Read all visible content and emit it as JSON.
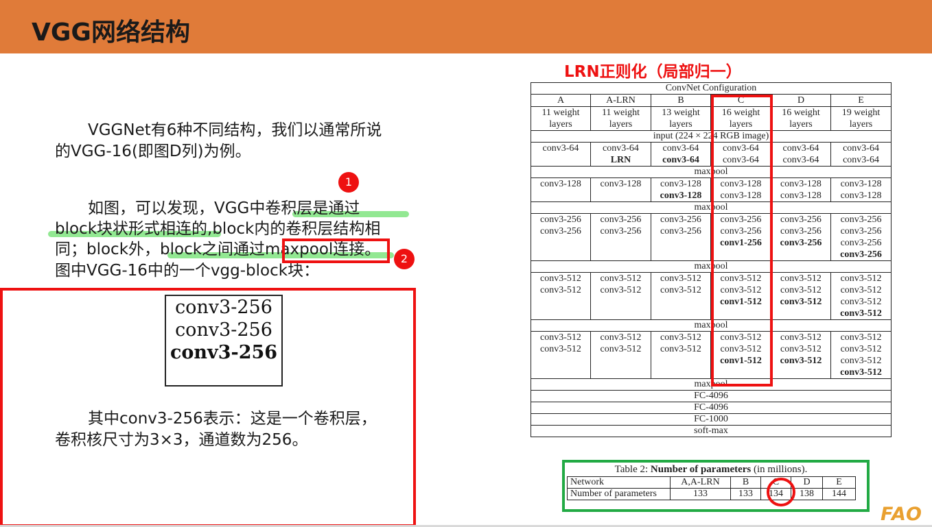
{
  "slide": {
    "title": "VGG网络结构",
    "paragraphs": {
      "p1_line1": "VGGNet有6种不同结构，我们以通常所说",
      "p1_line2": "的VGG-16(即图D列)为例。",
      "p2_line1": "如图，可以发现，VGG中卷积层是通过",
      "p2_line2": "block块状形式相连的,block内的卷积层结构相",
      "p2_line3": "同；block外，block之间通过maxpool连接。",
      "p2_line4": "图中VGG-16中的一个vgg-block块：",
      "p3_line1": "其中conv3-256表示：这是一个卷积层，",
      "p3_line2": "卷积核尺寸为3×3，通道数为256。"
    },
    "badges": [
      "1",
      "2"
    ],
    "block_figure": [
      "conv3-256",
      "conv3-256",
      "conv3-256"
    ],
    "lrn_title": "LRN正则化（局部归一）",
    "logo_text": "FAO",
    "colors": {
      "header": "#e07b39",
      "highlight": "#6ee06e",
      "red": "#ee1111",
      "green": "#22aa44"
    }
  },
  "config_table": {
    "caption": "ConvNet Configuration",
    "columns": [
      "A",
      "A-LRN",
      "B",
      "C",
      "D",
      "E"
    ],
    "descriptions": [
      [
        "11 weight",
        "layers"
      ],
      [
        "11 weight",
        "layers"
      ],
      [
        "13 weight",
        "layers"
      ],
      [
        "16 weight",
        "layers"
      ],
      [
        "16 weight",
        "layers"
      ],
      [
        "19 weight",
        "layers"
      ]
    ],
    "input": "input (224 × 224 RGB image)",
    "maxpool": "maxpool",
    "groups": [
      [
        [
          [
            "conv3-64"
          ]
        ],
        [
          [
            "conv3-64"
          ],
          [
            "LRN",
            "b"
          ]
        ],
        [
          [
            "conv3-64"
          ],
          [
            "conv3-64",
            "b"
          ]
        ],
        [
          [
            "conv3-64"
          ],
          [
            "conv3-64"
          ]
        ],
        [
          [
            "conv3-64"
          ],
          [
            "conv3-64"
          ]
        ],
        [
          [
            "conv3-64"
          ],
          [
            "conv3-64"
          ]
        ]
      ],
      [
        [
          [
            "conv3-128"
          ]
        ],
        [
          [
            "conv3-128"
          ]
        ],
        [
          [
            "conv3-128"
          ],
          [
            "conv3-128",
            "b"
          ]
        ],
        [
          [
            "conv3-128"
          ],
          [
            "conv3-128"
          ]
        ],
        [
          [
            "conv3-128"
          ],
          [
            "conv3-128"
          ]
        ],
        [
          [
            "conv3-128"
          ],
          [
            "conv3-128"
          ]
        ]
      ],
      [
        [
          [
            "conv3-256"
          ],
          [
            "conv3-256"
          ]
        ],
        [
          [
            "conv3-256"
          ],
          [
            "conv3-256"
          ]
        ],
        [
          [
            "conv3-256"
          ],
          [
            "conv3-256"
          ]
        ],
        [
          [
            "conv3-256"
          ],
          [
            "conv3-256"
          ],
          [
            "conv1-256",
            "b"
          ]
        ],
        [
          [
            "conv3-256"
          ],
          [
            "conv3-256"
          ],
          [
            "conv3-256",
            "b"
          ]
        ],
        [
          [
            "conv3-256"
          ],
          [
            "conv3-256"
          ],
          [
            "conv3-256"
          ],
          [
            "conv3-256",
            "b"
          ]
        ]
      ],
      [
        [
          [
            "conv3-512"
          ],
          [
            "conv3-512"
          ]
        ],
        [
          [
            "conv3-512"
          ],
          [
            "conv3-512"
          ]
        ],
        [
          [
            "conv3-512"
          ],
          [
            "conv3-512"
          ]
        ],
        [
          [
            "conv3-512"
          ],
          [
            "conv3-512"
          ],
          [
            "conv1-512",
            "b"
          ]
        ],
        [
          [
            "conv3-512"
          ],
          [
            "conv3-512"
          ],
          [
            "conv3-512",
            "b"
          ]
        ],
        [
          [
            "conv3-512"
          ],
          [
            "conv3-512"
          ],
          [
            "conv3-512"
          ],
          [
            "conv3-512",
            "b"
          ]
        ]
      ],
      [
        [
          [
            "conv3-512"
          ],
          [
            "conv3-512"
          ]
        ],
        [
          [
            "conv3-512"
          ],
          [
            "conv3-512"
          ]
        ],
        [
          [
            "conv3-512"
          ],
          [
            "conv3-512"
          ]
        ],
        [
          [
            "conv3-512"
          ],
          [
            "conv3-512"
          ],
          [
            "conv1-512",
            "b"
          ]
        ],
        [
          [
            "conv3-512"
          ],
          [
            "conv3-512"
          ],
          [
            "conv3-512",
            "b"
          ]
        ],
        [
          [
            "conv3-512"
          ],
          [
            "conv3-512"
          ],
          [
            "conv3-512"
          ],
          [
            "conv3-512",
            "b"
          ]
        ]
      ]
    ],
    "tail": [
      "maxpool",
      "FC-4096",
      "FC-4096",
      "FC-1000",
      "soft-max"
    ]
  },
  "param_table": {
    "caption_prefix": "Table 2: ",
    "caption_bold": "Number of parameters",
    "caption_suffix": " (in millions).",
    "header": [
      "Network",
      "A,A-LRN",
      "B",
      "C",
      "D",
      "E"
    ],
    "row": [
      "Number of parameters",
      "133",
      "133",
      "134",
      "138",
      "144"
    ]
  }
}
